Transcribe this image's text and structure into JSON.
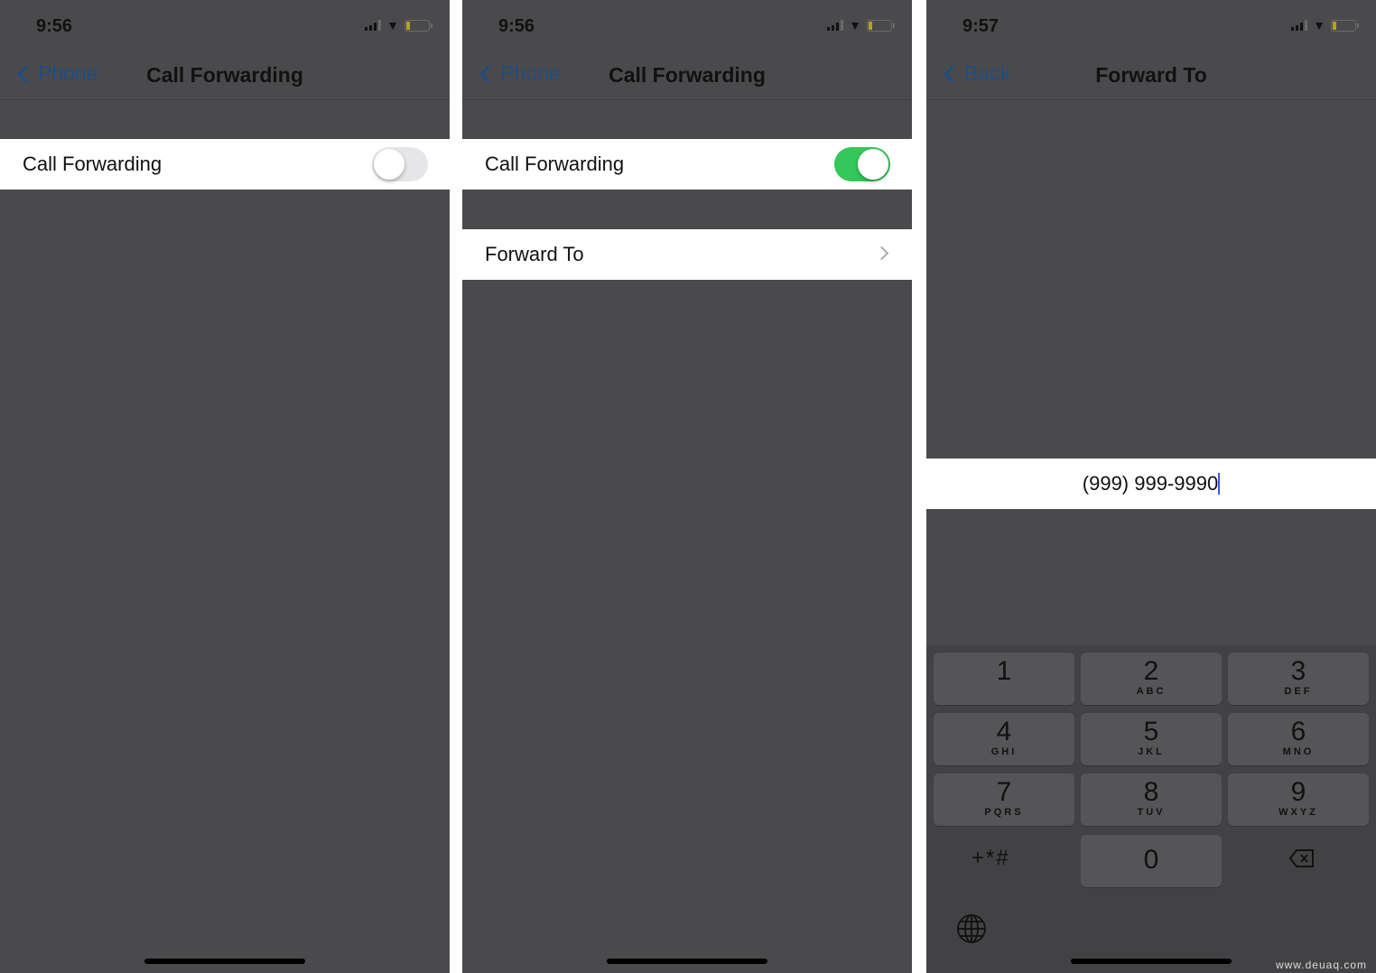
{
  "screens": [
    {
      "time": "9:56",
      "back_label": "Phone",
      "title": "Call Forwarding",
      "rows": [
        {
          "label": "Call Forwarding",
          "toggle_on": false
        }
      ]
    },
    {
      "time": "9:56",
      "back_label": "Phone",
      "title": "Call Forwarding",
      "rows": [
        {
          "label": "Call Forwarding",
          "toggle_on": true
        },
        {
          "label": "Forward To"
        }
      ]
    },
    {
      "time": "9:57",
      "back_label": "Back",
      "title": "Forward To",
      "phone_number": "(999) 999-9990",
      "keypad": [
        {
          "d": "1",
          "l": ""
        },
        {
          "d": "2",
          "l": "ABC"
        },
        {
          "d": "3",
          "l": "DEF"
        },
        {
          "d": "4",
          "l": "GHI"
        },
        {
          "d": "5",
          "l": "JKL"
        },
        {
          "d": "6",
          "l": "MNO"
        },
        {
          "d": "7",
          "l": "PQRS"
        },
        {
          "d": "8",
          "l": "TUV"
        },
        {
          "d": "9",
          "l": "WXYZ"
        },
        {
          "d": "0",
          "l": ""
        }
      ],
      "symbols_key": "+*#",
      "watermark": "www.deuaq.com"
    }
  ],
  "colors": {
    "toggle_on": "#34c759",
    "toggle_off": "#e6e6e8",
    "link": "#1f4d82",
    "background": "#4a4a4c"
  }
}
